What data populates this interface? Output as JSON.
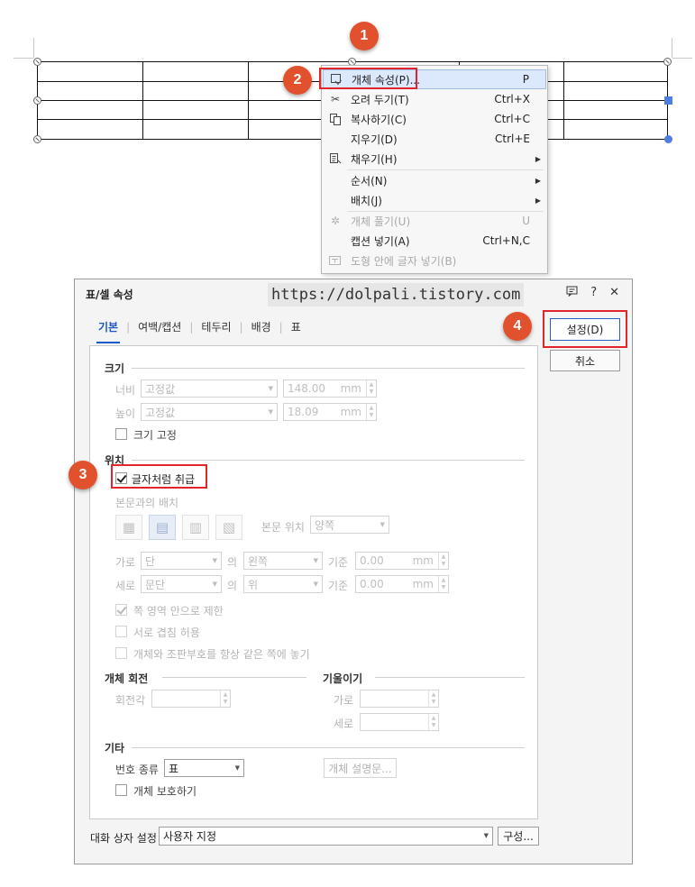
{
  "steps": [
    "1",
    "2",
    "3",
    "4"
  ],
  "context_menu": {
    "items": [
      {
        "label": "개체 속성(P)...",
        "shortcut": "P",
        "icon": "object-properties-icon",
        "state": "highlighted"
      },
      {
        "label": "오려 두기(T)",
        "shortcut": "Ctrl+X",
        "icon": "scissors-icon",
        "state": "normal"
      },
      {
        "label": "복사하기(C)",
        "shortcut": "Ctrl+C",
        "icon": "copy-icon",
        "state": "normal"
      },
      {
        "label": "지우기(D)",
        "shortcut": "Ctrl+E",
        "icon": "",
        "state": "normal"
      },
      {
        "label": "채우기(H)",
        "shortcut": "",
        "icon": "fill-icon",
        "submenu": true,
        "state": "normal"
      },
      {
        "label": "순서(N)",
        "shortcut": "",
        "icon": "",
        "submenu": true,
        "state": "normal"
      },
      {
        "label": "배치(J)",
        "shortcut": "",
        "icon": "",
        "submenu": true,
        "state": "normal"
      },
      {
        "label": "개체 풀기(U)",
        "shortcut": "U",
        "icon": "ungroup-icon",
        "state": "disabled"
      },
      {
        "label": "캡션 넣기(A)",
        "shortcut": "Ctrl+N,C",
        "icon": "",
        "state": "normal"
      },
      {
        "label": "도형 안에 글자 넣기(B)",
        "shortcut": "",
        "icon": "text-in-shape-icon",
        "state": "disabled"
      }
    ]
  },
  "dialog": {
    "title": "표/셀 속성",
    "watermark": "https://dolpali.tistory.com",
    "tabs": [
      "기본",
      "여백/캡션",
      "테두리",
      "배경",
      "표"
    ],
    "active_tab": "기본",
    "ok_button": "설정(D)",
    "cancel_button": "취소",
    "size": {
      "section": "크기",
      "width_label": "너비",
      "width_mode": "고정값",
      "width_value": "148.00",
      "height_label": "높이",
      "height_mode": "고정값",
      "height_value": "18.09",
      "unit": "mm",
      "fix_size_label": "크기 고정",
      "fix_size_checked": false
    },
    "position": {
      "section": "위치",
      "treat_as_char_label": "글자처럼 취급",
      "treat_as_char_checked": true,
      "wrap_label": "본문과의 배치",
      "body_pos_label": "본문 위치",
      "body_pos_value": "양쪽",
      "horiz_label": "가로",
      "horiz_ref": "단",
      "of_label": "의",
      "horiz_align": "왼쪽",
      "base_label": "기준",
      "horiz_offset": "0.00",
      "vert_label": "세로",
      "vert_ref": "문단",
      "vert_align": "위",
      "vert_offset": "0.00",
      "unit": "mm",
      "limit_in_page_label": "쪽 영역 안으로 제한",
      "limit_in_page_checked": true,
      "allow_overlap_label": "서로 겹침 허용",
      "allow_overlap_checked": false,
      "keep_with_anchor_label": "개체와 조판부호를 항상 같은 쪽에 놓기",
      "keep_with_anchor_checked": false
    },
    "rotation": {
      "section": "개체 회전",
      "angle_label": "회전각",
      "angle_value": ""
    },
    "skew": {
      "section": "기울이기",
      "horiz_label": "가로",
      "horiz_value": "",
      "vert_label": "세로",
      "vert_value": ""
    },
    "etc": {
      "section": "기타",
      "number_type_label": "번호 종류",
      "number_type_value": "표",
      "description_button": "개체 설명문...",
      "protect_label": "개체 보호하기",
      "protect_checked": false
    },
    "footer": {
      "preset_label": "대화 상자 설정",
      "preset_value": "사용자 지정",
      "config_button": "구성..."
    }
  }
}
